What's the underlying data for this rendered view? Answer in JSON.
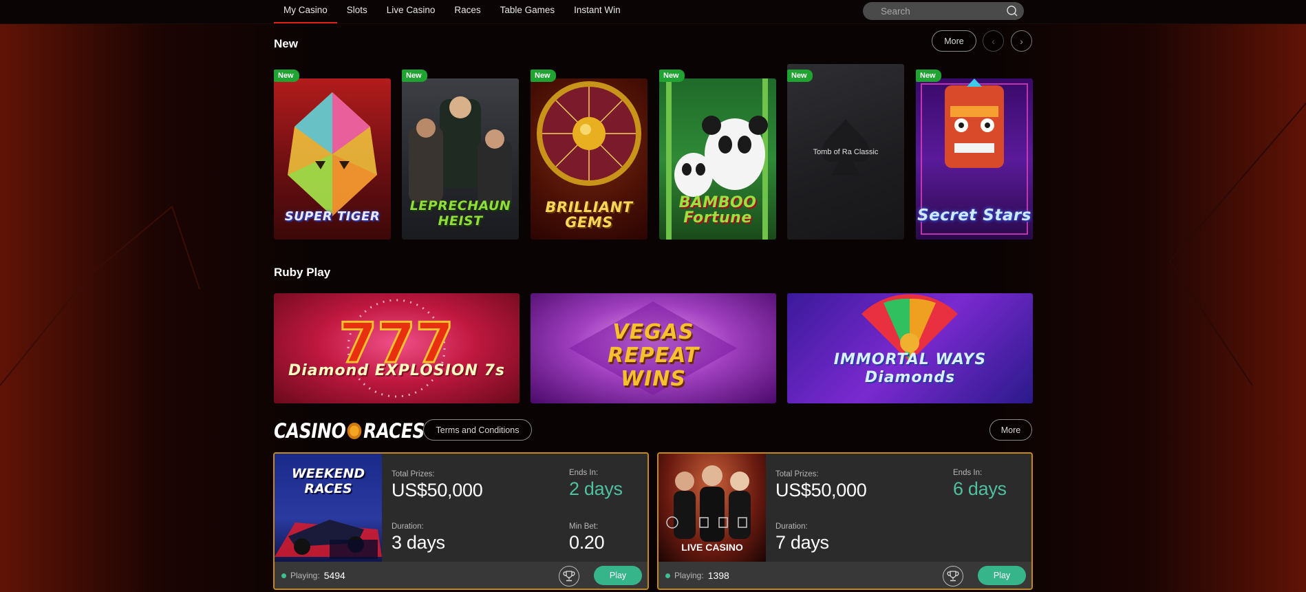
{
  "nav": {
    "tabs": [
      {
        "label": "My Casino",
        "active": true
      },
      {
        "label": "Slots"
      },
      {
        "label": "Live Casino"
      },
      {
        "label": "Races"
      },
      {
        "label": "Table Games"
      },
      {
        "label": "Instant Win"
      }
    ],
    "search_placeholder": "Search",
    "accent": "#e0231a"
  },
  "new_section": {
    "title": "New",
    "more_label": "More",
    "badge": "New",
    "games": [
      {
        "title": "SUPER TIGER"
      },
      {
        "title": "LEPRECHAUN HEIST"
      },
      {
        "title": "BRILLIANT GEMS"
      },
      {
        "title": "BAMBOO Fortune"
      },
      {
        "title": "Tomb of Ra Classic"
      },
      {
        "title": "Secret Stars"
      }
    ]
  },
  "ruby_section": {
    "title": "Ruby Play",
    "games": [
      {
        "title": "Diamond EXPLOSION 7s"
      },
      {
        "title": "VEGAS REPEAT WINS"
      },
      {
        "title": "IMMORTAL WAYS Diamonds"
      }
    ]
  },
  "races": {
    "logo_left": "CASINO",
    "logo_right": "RACES",
    "terms_label": "Terms and Conditions",
    "more_label": "More",
    "cards": [
      {
        "image_text": "WEEKEND RACES",
        "prizes_label": "Total Prizes:",
        "prizes": "US$50,000",
        "ends_label": "Ends In:",
        "ends": "2 days",
        "duration_label": "Duration:",
        "duration": "3 days",
        "minbet_label": "Min Bet:",
        "minbet": "0.20",
        "playing_label": "Playing:",
        "playing": "5494",
        "play_label": "Play"
      },
      {
        "image_text": "LIVE CASINO",
        "prizes_label": "Total Prizes:",
        "prizes": "US$50,000",
        "ends_label": "Ends In:",
        "ends": "6 days",
        "duration_label": "Duration:",
        "duration": "7 days",
        "playing_label": "Playing:",
        "playing": "1398",
        "play_label": "Play"
      }
    ]
  }
}
